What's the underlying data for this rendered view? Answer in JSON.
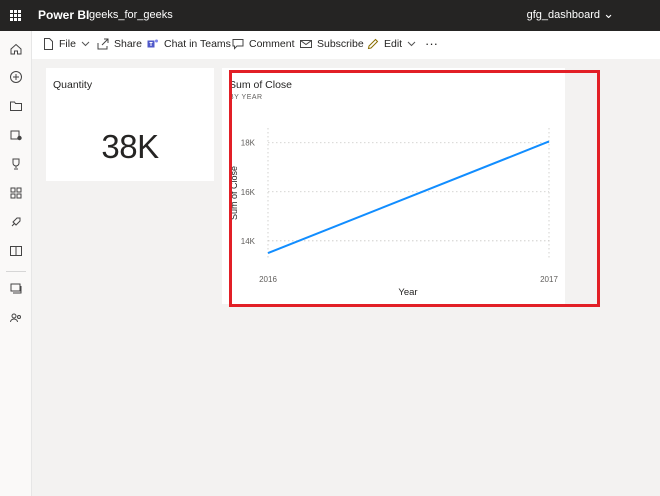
{
  "topbar": {
    "app_name": "Power BI",
    "workspace": "geeks_for_geeks",
    "report_title": "gfg_dashboard",
    "chevron_glyph": "⌄"
  },
  "leftnav": {
    "icons": [
      "home-icon",
      "create-icon",
      "browse-icon",
      "data-hub-icon",
      "goals-icon",
      "apps-icon",
      "deployment-icon",
      "learn-icon",
      "workspaces-icon",
      "my-workspace-icon"
    ]
  },
  "toolbar": {
    "file_label": "File",
    "share_label": "Share",
    "chat_label": "Chat in Teams",
    "comment_label": "Comment",
    "subscribe_label": "Subscribe",
    "edit_label": "Edit",
    "more_label": "···"
  },
  "card": {
    "title": "Quantity",
    "value": "38K"
  },
  "chart_data": {
    "type": "line",
    "title": "Sum of Close",
    "subtitle": "BY YEAR",
    "xlabel": "Year",
    "ylabel": "Sum of Close",
    "x": [
      "2016",
      "2017"
    ],
    "series": [
      {
        "values": [
          13500,
          18050
        ],
        "color": "#118dff"
      }
    ],
    "yticks": [
      14000,
      16000,
      18000
    ],
    "ytick_labels": [
      "14K",
      "16K",
      "18K"
    ],
    "ylim": [
      13300,
      18600
    ],
    "grid": true
  },
  "highlight_color": "#e21f26"
}
